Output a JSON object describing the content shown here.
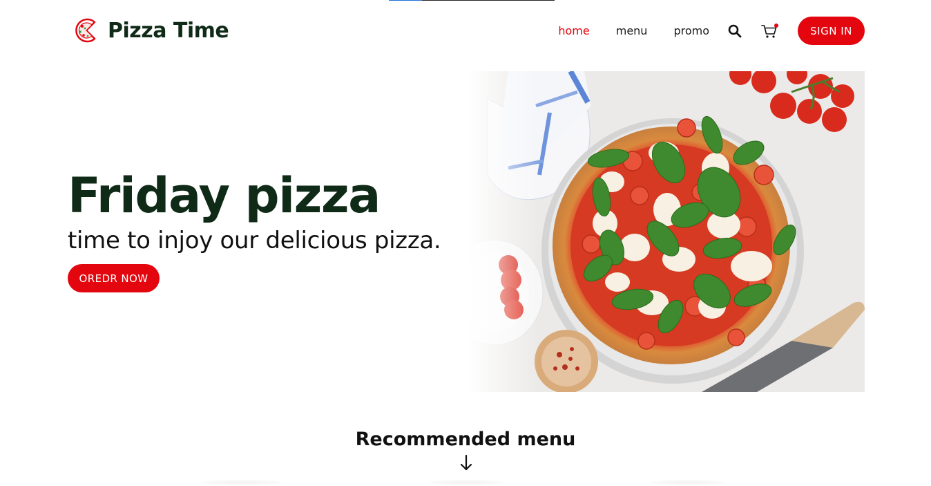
{
  "brand": {
    "name": "Pizza Time",
    "logo_icon": "pizza-logo-icon"
  },
  "nav": {
    "links": [
      {
        "label": "home",
        "active": true
      },
      {
        "label": "menu",
        "active": false
      },
      {
        "label": "promo",
        "active": false
      }
    ],
    "search_icon": "search-icon",
    "cart_icon": "cart-icon",
    "sign_in_label": "SIGN IN"
  },
  "hero": {
    "title": "Friday pizza",
    "subtitle": "time to injoy our delicious pizza.",
    "order_label": "OREDR NOW",
    "image": "margherita-pizza-photo"
  },
  "recommended": {
    "title": "Recommended menu",
    "arrow_icon": "arrow-down-icon"
  },
  "colors": {
    "accent": "#e3060f",
    "brand_text": "#0f2a16"
  }
}
